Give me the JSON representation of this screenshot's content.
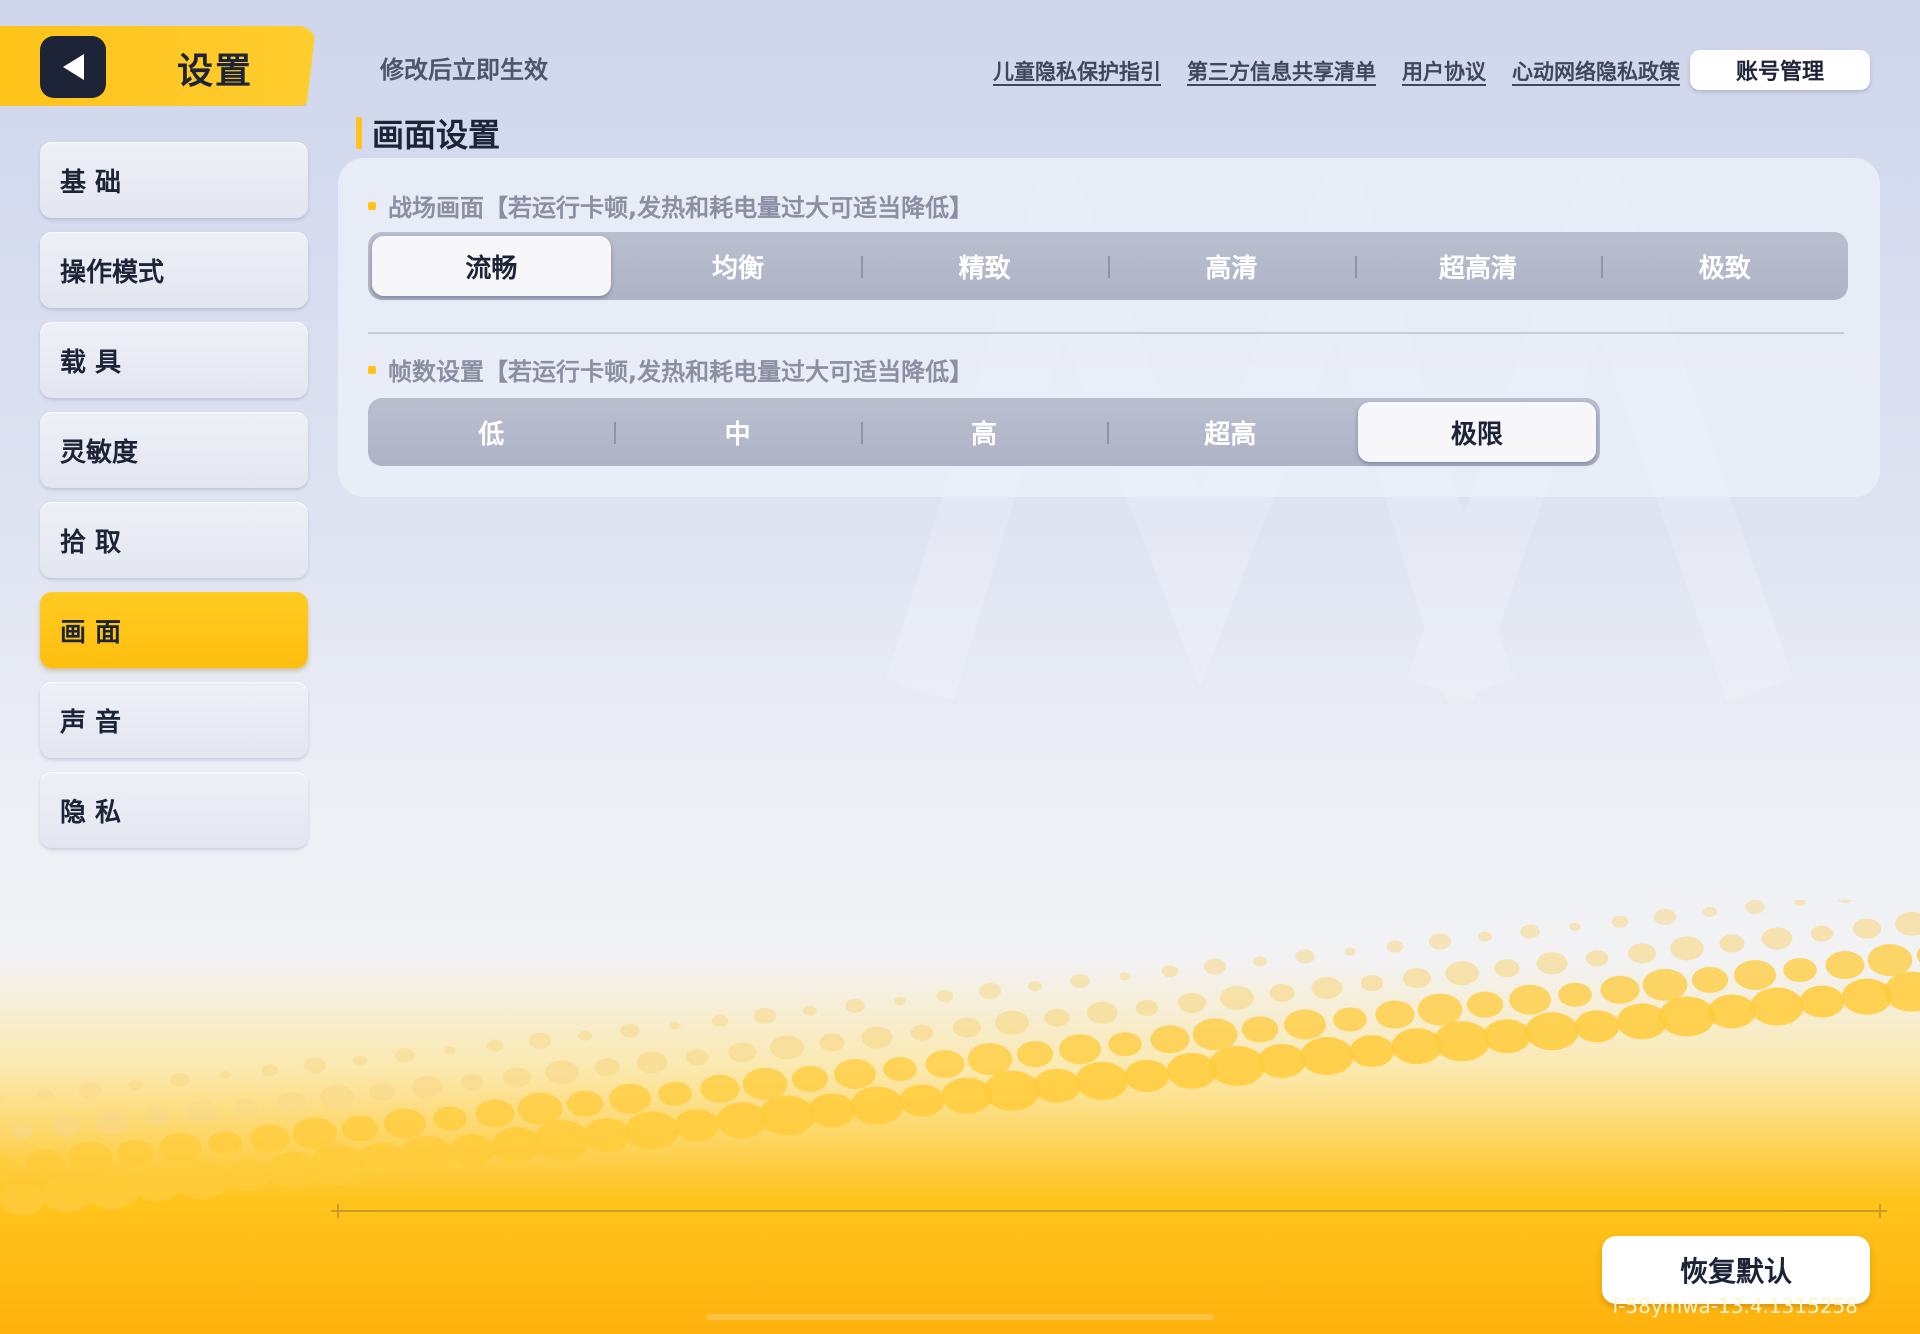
{
  "header": {
    "title": "设置",
    "hint": "修改后立即生效",
    "links": [
      "儿童隐私保护指引",
      "第三方信息共享清单",
      "用户协议",
      "心动网络隐私政策"
    ],
    "account_button": "账号管理"
  },
  "sidebar": {
    "items": [
      {
        "label": "基 础",
        "active": false
      },
      {
        "label": "操作模式",
        "active": false
      },
      {
        "label": "载 具",
        "active": false
      },
      {
        "label": "灵敏度",
        "active": false
      },
      {
        "label": "拾 取",
        "active": false
      },
      {
        "label": "画 面",
        "active": true
      },
      {
        "label": "声 音",
        "active": false
      },
      {
        "label": "隐 私",
        "active": false
      }
    ]
  },
  "section": {
    "title": "画面设置",
    "graphics": {
      "label": "战场画面【若运行卡顿,发热和耗电量过大可适当降低】",
      "options": [
        "流畅",
        "均衡",
        "精致",
        "高清",
        "超高清",
        "极致"
      ],
      "selected": "流畅"
    },
    "framerate": {
      "label": "帧数设置【若运行卡顿,发热和耗电量过大可适当降低】",
      "options": [
        "低",
        "中",
        "高",
        "超高",
        "极限"
      ],
      "selected": "极限"
    }
  },
  "footer": {
    "restore_button": "恢复默认",
    "version": "f-58ymwa-13.4.1315258"
  },
  "colors": {
    "accent": "#ffc31a",
    "dark": "#1d2438"
  }
}
